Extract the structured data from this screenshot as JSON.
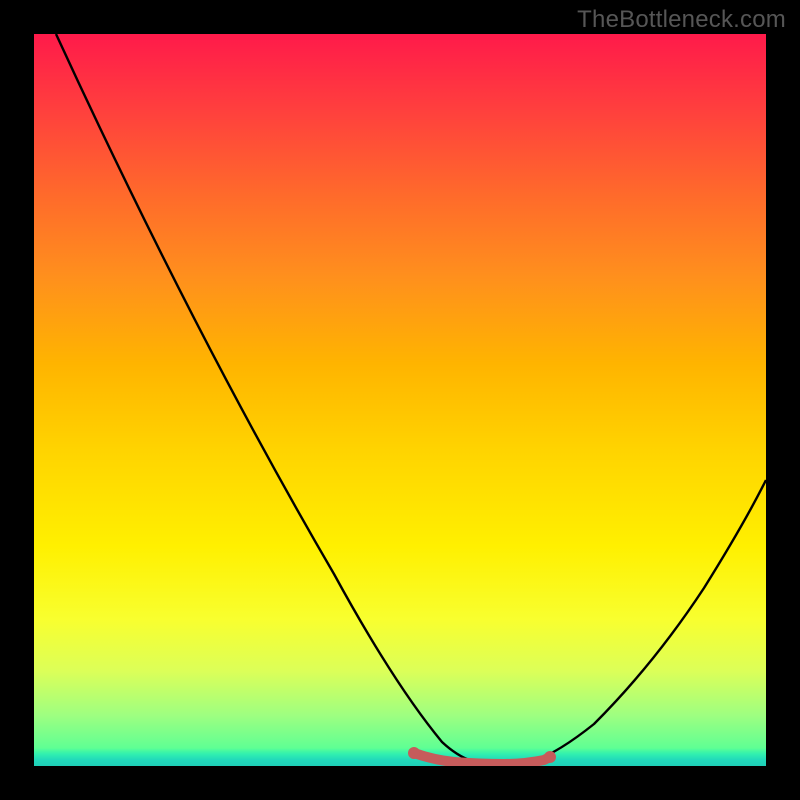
{
  "watermark": "TheBottleneck.com",
  "chart_data": {
    "type": "line",
    "title": "",
    "xlabel": "",
    "ylabel": "",
    "xlim": [
      0,
      100
    ],
    "ylim": [
      0,
      100
    ],
    "grid": false,
    "legend": false,
    "curve_left": {
      "x": [
        3,
        10,
        20,
        30,
        40,
        48,
        52,
        56,
        59,
        61
      ],
      "y": [
        100,
        84,
        65,
        47,
        28,
        12,
        5,
        1.6,
        0.6,
        0.3
      ]
    },
    "curve_right": {
      "x": [
        61,
        65,
        70,
        75,
        80,
        86,
        92,
        97,
        100
      ],
      "y": [
        0.3,
        0.5,
        1.6,
        4,
        8,
        14,
        22,
        30,
        36
      ]
    },
    "flat_segment": {
      "color": "#c86060",
      "x": [
        52,
        54,
        56,
        58,
        60,
        62,
        64,
        66,
        68,
        70
      ],
      "y": [
        1.6,
        1.2,
        0.9,
        0.6,
        0.4,
        0.4,
        0.6,
        0.9,
        1.2,
        1.6
      ]
    },
    "gradient_stops": [
      {
        "pos": 0.0,
        "color": "#ff1a4a"
      },
      {
        "pos": 0.45,
        "color": "#ffd400"
      },
      {
        "pos": 0.8,
        "color": "#f8ff2f"
      },
      {
        "pos": 1.0,
        "color": "#3dff9e"
      }
    ]
  }
}
